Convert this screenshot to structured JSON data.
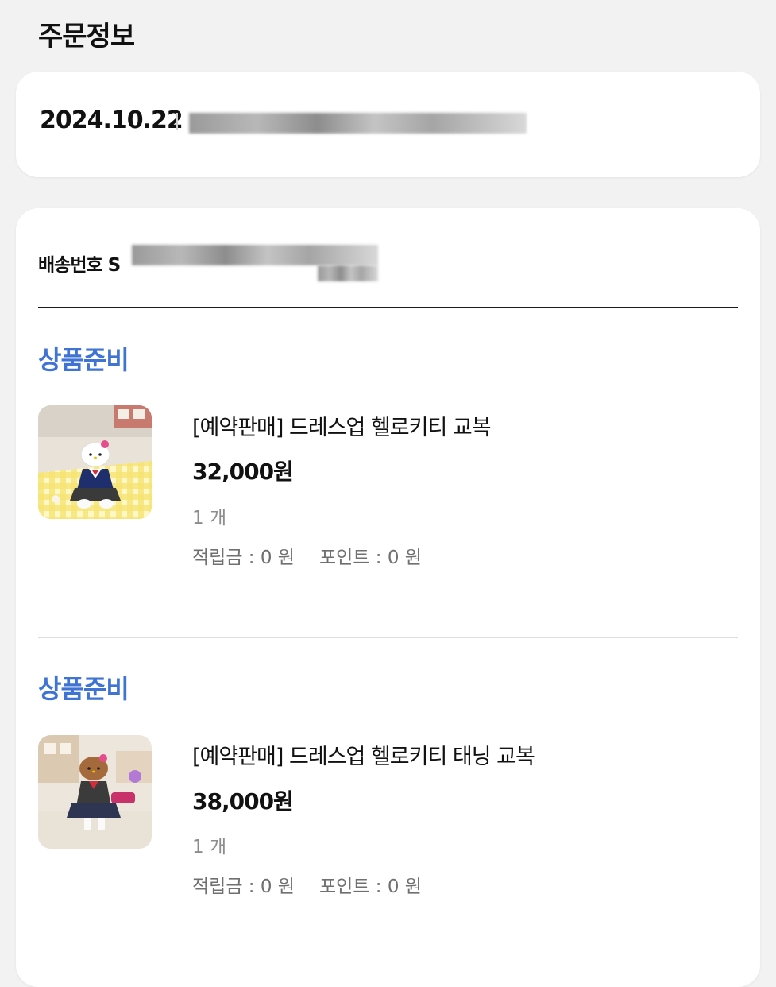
{
  "header": {
    "title": "주문정보"
  },
  "order": {
    "date": "2024.10.22"
  },
  "shipment": {
    "label": "배송번호 S"
  },
  "items": [
    {
      "status": "상품준비",
      "name": "[예약판매] 드레스업 헬로키티 교복",
      "price": "32,000원",
      "quantity": "1 개",
      "reward_points": "적립금 : 0 원",
      "points": "포인트 : 0 원"
    },
    {
      "status": "상품준비",
      "name": "[예약판매] 드레스업 헬로키티 태닝 교복",
      "price": "38,000원",
      "quantity": "1 개",
      "reward_points": "적립금 : 0 원",
      "points": "포인트 : 0 원"
    }
  ],
  "colors": {
    "background": "#f2f2f2",
    "card": "#ffffff",
    "status_blue": "#3f74d4",
    "muted_text": "#8c8c8c"
  },
  "icons": {
    "item_1_thumbnail": "hello-kitty-uniform-figure",
    "item_2_thumbnail": "hello-kitty-tanned-uniform-figure"
  }
}
